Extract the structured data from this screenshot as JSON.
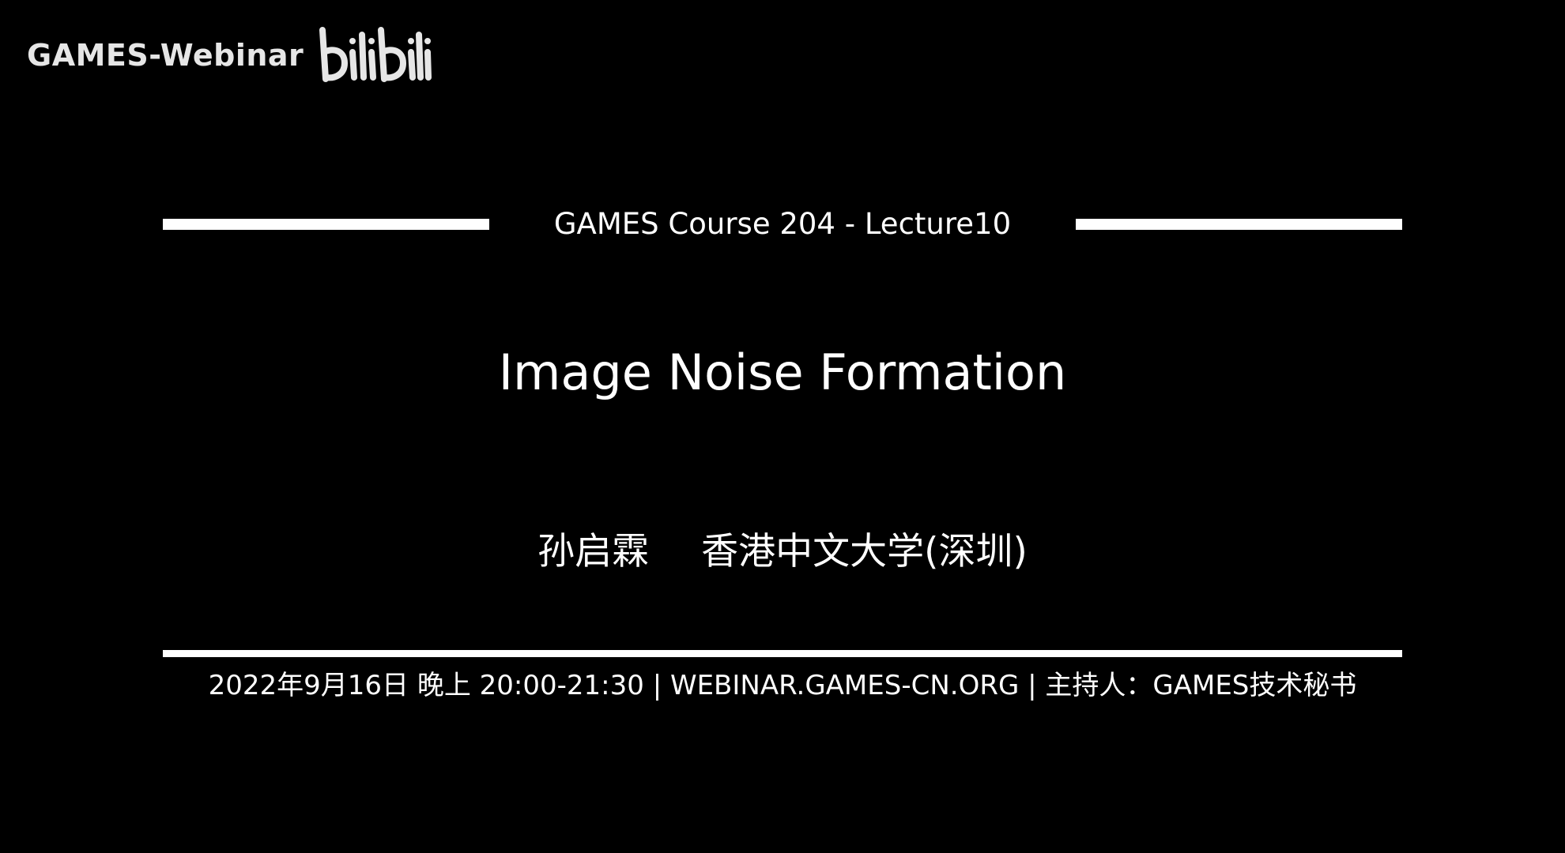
{
  "watermark": {
    "text": "GAMES-Webinar",
    "logo_text": "bilibili",
    "logo_icon": "bilibili-logo-icon"
  },
  "slide": {
    "course_line": "GAMES Course 204 - Lecture10",
    "title": "Image Noise Formation",
    "speaker": "孙启霖",
    "affiliation": "香港中文大学(深圳)",
    "footer": "2022年9月16日 晚上 20:00-21:30 | WEBINAR.GAMES-CN.ORG | 主持人：GAMES技术秘书"
  },
  "colors": {
    "background": "#000000",
    "text": "#ffffff",
    "watermark": "#e6e6e6"
  }
}
